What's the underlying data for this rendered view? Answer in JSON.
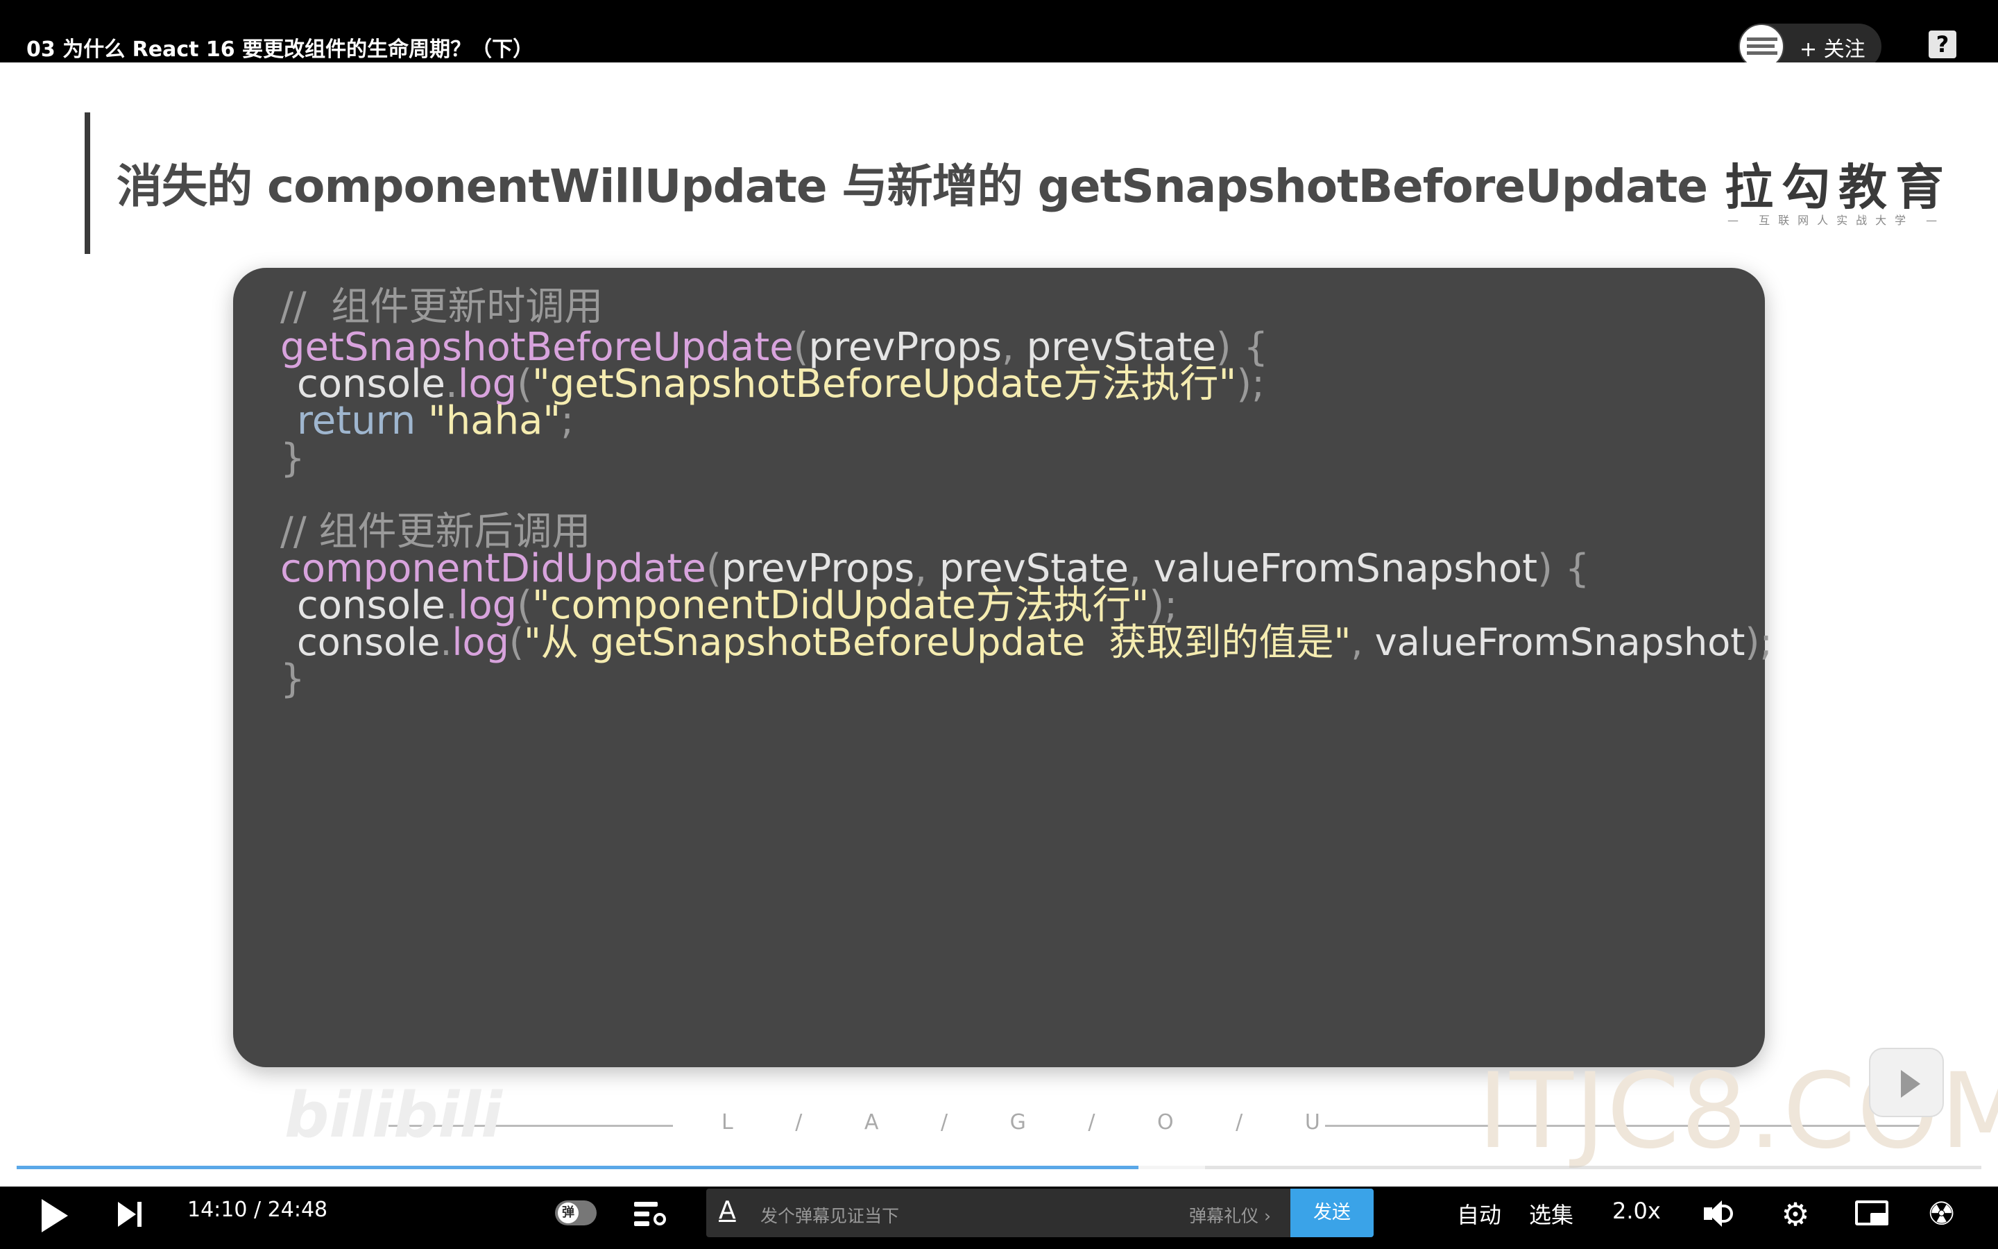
{
  "topbar": {
    "title": "03 为什么 React 16 要更改组件的生命周期？（下）",
    "follow_label": "+ 关注",
    "help_label": "?"
  },
  "slide": {
    "title": "消失的 componentWillUpdate 与新增的 getSnapshotBeforeUpdate",
    "brand": "拉勾教育",
    "brand_sub": "— 互联网人实战大学 —",
    "lagou": "L / A / G / O / U"
  },
  "code": {
    "l1_comment": "//  组件更新时调用",
    "l2_fn": "getSnapshotBeforeUpdate",
    "l2_open": "(",
    "l2_p1": "prevProps",
    "l2_sep": ", ",
    "l2_p2": "prevState",
    "l2_close": ") {",
    "l3_obj": "console",
    "l3_dot": ".",
    "l3_log": "log",
    "l3_open": "(",
    "l3_str": "\"getSnapshotBeforeUpdate方法执行\"",
    "l3_close": ");",
    "l4_kw": "return",
    "l4_str": "\"haha\"",
    "l4_semi": ";",
    "l5_brace": "}",
    "l6_comment": "// 组件更新后调用",
    "l7_fn": "componentDidUpdate",
    "l7_open": "(",
    "l7_p1": "prevProps",
    "l7_sep1": ", ",
    "l7_p2": "prevState",
    "l7_sep2": ", ",
    "l7_p3": "valueFromSnapshot",
    "l7_close": ") {",
    "l8_obj": "console",
    "l8_dot": ".",
    "l8_log": "log",
    "l8_open": "(",
    "l8_str": "\"componentDidUpdate方法执行\"",
    "l8_close": ");",
    "l9_obj": "console",
    "l9_dot": ".",
    "l9_log": "log",
    "l9_open": "(",
    "l9_str": "\"从 getSnapshotBeforeUpdate  获取到的值是\"",
    "l9_sep": ", ",
    "l9_arg": "valueFromSnapshot",
    "l9_close": ");",
    "l10_brace": "}"
  },
  "watermarks": {
    "bilibili": "bilibili",
    "itjc": "ITJC8.COM"
  },
  "progress": {
    "played_fraction": 0.571,
    "buffered_fraction": 0.605
  },
  "controls": {
    "current_time": "14:10",
    "separator": "/",
    "duration": "24:48",
    "danmaku_toggle_label": "弹",
    "font_icon": "A",
    "danmaku_placeholder": "发个弹幕见证当下",
    "danmaku_etiquette": "弹幕礼仪 ›",
    "send_label": "发送",
    "quality_label": "自动",
    "episodes_label": "选集",
    "speed_label": "2.0x"
  },
  "colors": {
    "progress": "#5aa8e8",
    "send_button": "#3aa3e8",
    "code_card": "#464646",
    "code_function": "#d8a3dd",
    "code_string": "#f5ecb0",
    "code_keyword": "#9fb6cf"
  },
  "icons": [
    "play-icon",
    "next-icon",
    "danmaku-settings-icon",
    "font-icon",
    "volume-icon",
    "gear-icon",
    "pip-icon",
    "fan-icon",
    "help-icon"
  ]
}
